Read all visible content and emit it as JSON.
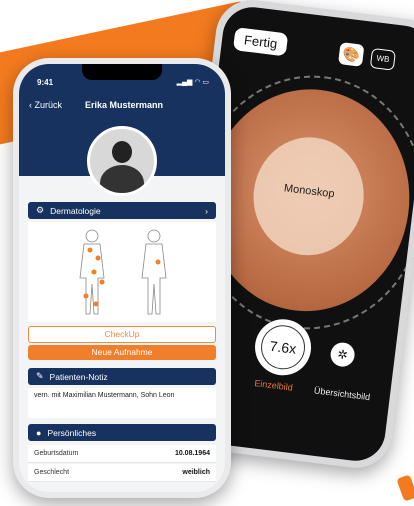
{
  "camera": {
    "done_label": "Fertig",
    "wb_label": "WB",
    "overlay_label": "Monoskop",
    "zoom_value": "7.6x",
    "mode_single": "Einzelbild",
    "mode_overview": "Übersichtsbild"
  },
  "patient": {
    "status_time": "9:41",
    "back_label": "Zurück",
    "name": "Erika Mustermann",
    "section_dermatology": "Dermatologie",
    "checkup_label": "CheckUp",
    "new_capture_label": "Neue Aufnahme",
    "section_note": "Patienten-Notiz",
    "note_text": "vern. mit Maximilian Mustermann, Sohn Leon",
    "section_personal": "Persönliches",
    "fields": [
      {
        "label": "Geburtsdatum",
        "value": "10.08.1964"
      },
      {
        "label": "Geschlecht",
        "value": "weiblich"
      }
    ]
  },
  "colors": {
    "navy": "#17325e",
    "orange": "#f07e2a"
  }
}
